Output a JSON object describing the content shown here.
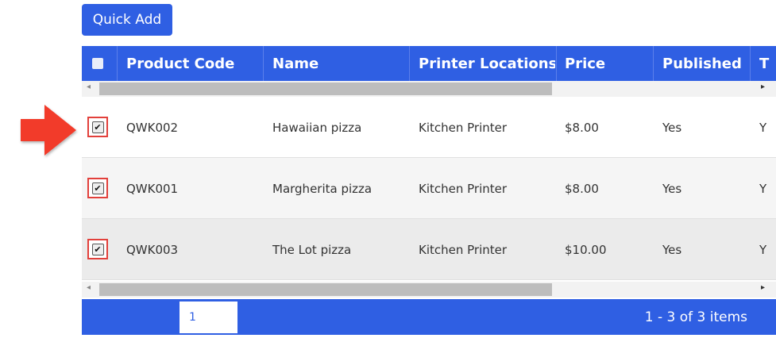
{
  "toolbar": {
    "quick_add_label": "Quick Add"
  },
  "table": {
    "columns": [
      {
        "label": "Product Code"
      },
      {
        "label": "Name"
      },
      {
        "label": "Printer Locations"
      },
      {
        "label": "Price"
      },
      {
        "label": "Published"
      },
      {
        "label": "T"
      }
    ],
    "rows": [
      {
        "code": "QWK002",
        "name": "Hawaiian pizza",
        "printer": "Kitchen Printer",
        "price": "$8.00",
        "published": "Yes",
        "extra": "Y",
        "checked": true
      },
      {
        "code": "QWK001",
        "name": "Margherita pizza",
        "printer": "Kitchen Printer",
        "price": "$8.00",
        "published": "Yes",
        "extra": "Y",
        "checked": true
      },
      {
        "code": "QWK003",
        "name": "The Lot pizza",
        "printer": "Kitchen Printer",
        "price": "$10.00",
        "published": "Yes",
        "extra": "Y",
        "checked": true
      }
    ],
    "check_mark": "✔",
    "scroll_left": "◂",
    "scroll_right": "▸"
  },
  "pager": {
    "current_page": "1",
    "info": "1 - 3 of 3 items"
  },
  "colors": {
    "accent": "#2f5fe3",
    "highlight": "#e2403b",
    "arrow": "#f23a2b"
  }
}
